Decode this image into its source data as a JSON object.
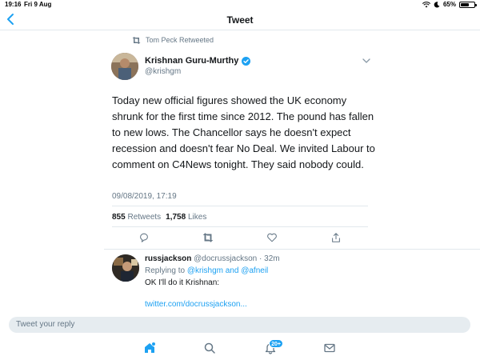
{
  "status_bar": {
    "time": "19:16",
    "date": "Fri 9 Aug",
    "battery": "65%",
    "battery_level": 0.65
  },
  "header": {
    "title": "Tweet"
  },
  "retweet_context": {
    "label": "Tom Peck Retweeted"
  },
  "tweet": {
    "author_name": "Krishnan Guru-Murthy",
    "author_handle": "@krishgm",
    "text": "Today new official figures showed the UK economy shrunk for the first time since 2012. The pound has fallen to new lows. The Chancellor says he doesn't expect recession and doesn't fear No Deal. We invited Labour to comment on C4News tonight. They said nobody could.",
    "timestamp": "09/08/2019, 17:19",
    "retweets_count": "855",
    "retweets_label": "Retweets",
    "likes_count": "1,758",
    "likes_label": "Likes"
  },
  "reply": {
    "name": "russjackson",
    "handle": "@docrussjackson",
    "separator": "·",
    "age": "32m",
    "replying_to_prefix": "Replying to",
    "replying_to_users": "@krishgm and @afneil",
    "text": "OK I'll do it Krishnan:",
    "link": "twitter.com/docrussjackson..."
  },
  "composer": {
    "placeholder": "Tweet your reply"
  },
  "tabbar": {
    "notifications_badge": "20+"
  },
  "colors": {
    "accent": "#1da1f2",
    "secondary_text": "#657786",
    "divider": "#e1e8ed",
    "composer_bg": "#e6ecf0"
  }
}
